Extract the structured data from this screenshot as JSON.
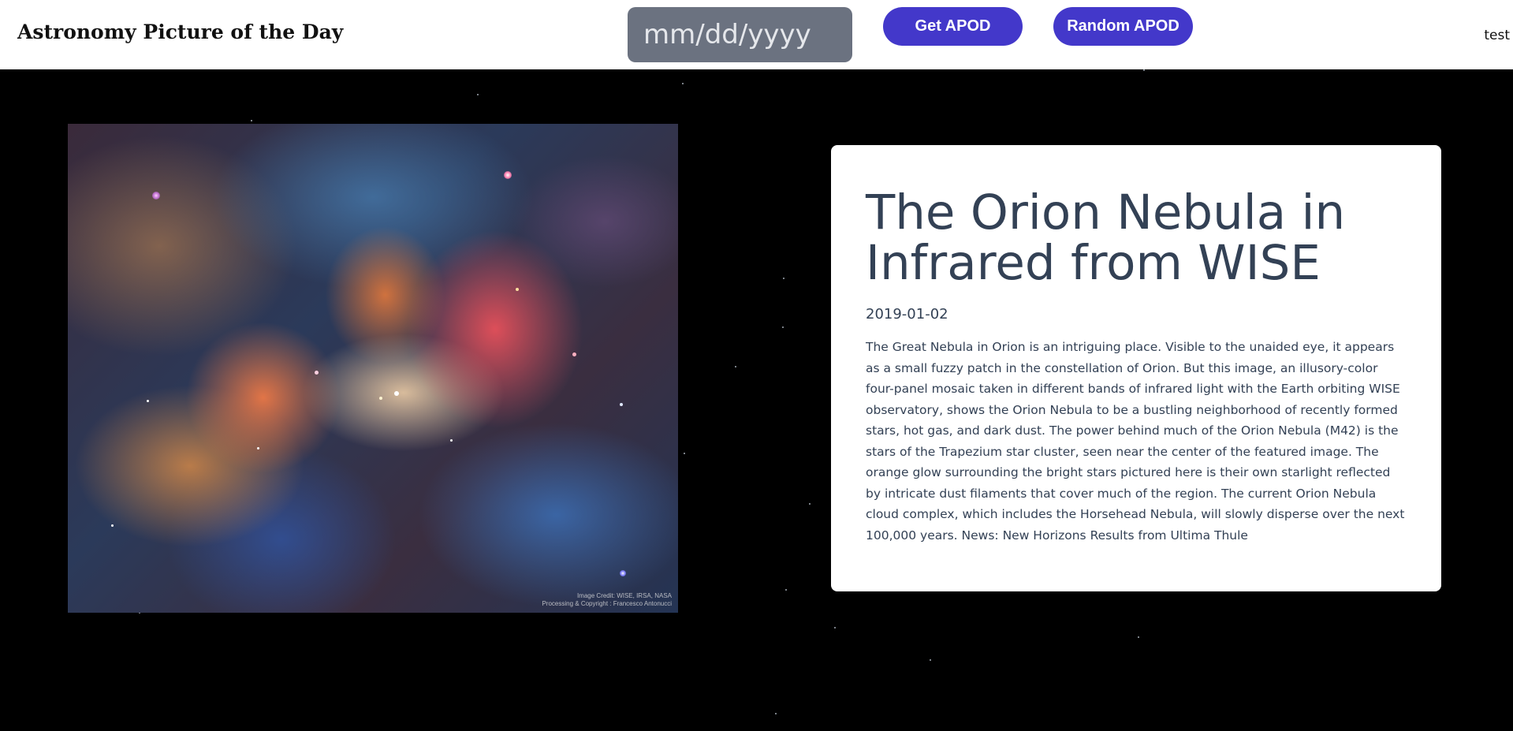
{
  "header": {
    "site_title": "Astronomy Picture of the Day",
    "date_placeholder": "mm/dd/yyyy",
    "get_button_label": "Get APOD",
    "random_button_label": "Random APOD",
    "user_label": "test"
  },
  "apod": {
    "title": "The Orion Nebula in Infrared from WISE",
    "date": "2019-01-02",
    "explanation": "The Great Nebula in Orion is an intriguing place. Visible to the unaided eye, it appears as a small fuzzy patch in the constellation of Orion. But this image, an illusory-color four-panel mosaic taken in different bands of infrared light with the Earth orbiting WISE observatory, shows the Orion Nebula to be a bustling neighborhood of recently formed stars, hot gas, and dark dust. The power behind much of the Orion Nebula (M42) is the stars of the Trapezium star cluster, seen near the center of the featured image. The orange glow surrounding the bright stars pictured here is their own starlight reflected by intricate dust filaments that cover much of the region. The current Orion Nebula cloud complex, which includes the Horsehead Nebula, will slowly disperse over the next 100,000 years. News: New Horizons Results from Ultima Thule",
    "image_credit_line1": "Image Credit: WISE, IRSA, NASA",
    "image_credit_line2": "Processing & Copyright : Francesco Antonucci"
  },
  "colors": {
    "page_background": "#000000",
    "header_background": "#ffffff",
    "button_accent": "#4338ca",
    "date_input_background": "#6b7280",
    "card_text": "#334155"
  },
  "icons": {
    "background": "starfield",
    "image": "orion-nebula-photo"
  }
}
